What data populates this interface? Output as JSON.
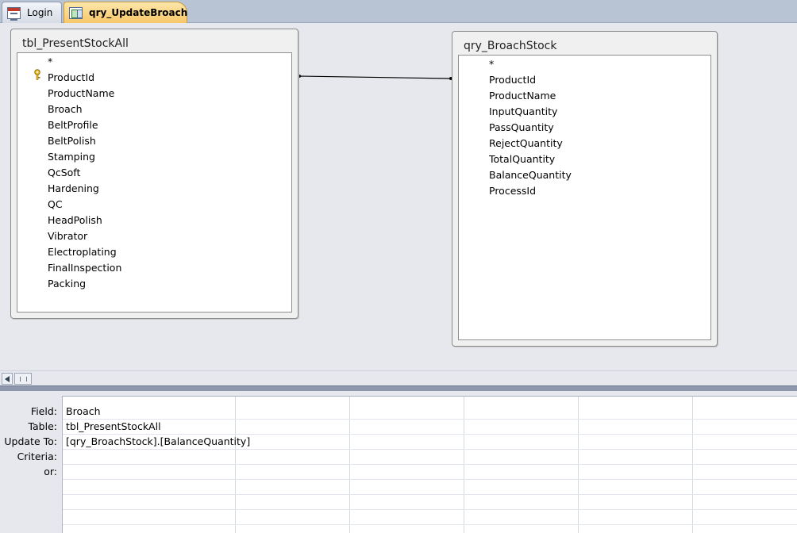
{
  "tabs": [
    {
      "label": "Login",
      "icon": "form-icon"
    },
    {
      "label": "qry_UpdateBroach",
      "icon": "query-icon"
    }
  ],
  "tables": [
    {
      "title": "tbl_PresentStockAll",
      "fields": [
        "*",
        "ProductId",
        "ProductName",
        "Broach",
        "BeltProfile",
        "BeltPolish",
        "Stamping",
        "QcSoft",
        "Hardening",
        "QC",
        "HeadPolish",
        "Vibrator",
        "Electroplating",
        "FinalInspection",
        "Packing"
      ],
      "primary_key": "ProductId"
    },
    {
      "title": "qry_BroachStock",
      "fields": [
        "*",
        "ProductId",
        "ProductName",
        "InputQuantity",
        "PassQuantity",
        "RejectQuantity",
        "TotalQuantity",
        "BalanceQuantity",
        "ProcessId"
      ]
    }
  ],
  "grid": {
    "row_labels": [
      "Field:",
      "Table:",
      "Update To:",
      "Criteria:",
      "or:"
    ],
    "columns": [
      {
        "field": "Broach",
        "table": "tbl_PresentStockAll",
        "update_to": "[qry_BroachStock].[BalanceQuantity]",
        "criteria": "",
        "or": ""
      }
    ]
  }
}
